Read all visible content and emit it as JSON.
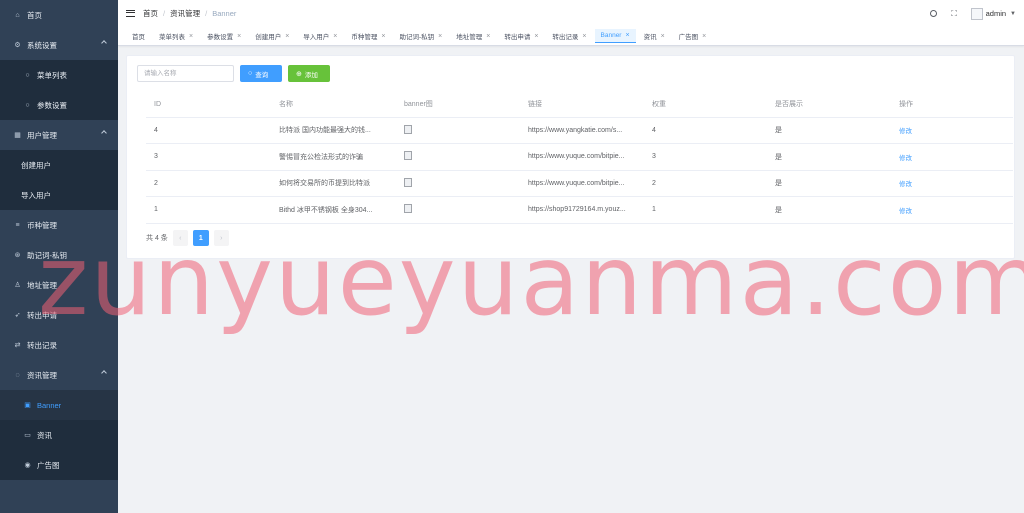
{
  "sidebar": {
    "items": [
      {
        "label": "首页",
        "icon": "home-icon",
        "type": "top"
      },
      {
        "label": "系统设置",
        "icon": "gear-icon",
        "type": "group"
      },
      {
        "label": "菜单列表",
        "icon": "circle-icon",
        "type": "sub"
      },
      {
        "label": "参数设置",
        "icon": "circle-icon",
        "type": "sub"
      },
      {
        "label": "用户管理",
        "icon": "users-icon",
        "type": "group"
      },
      {
        "label": "创建用户",
        "icon": "",
        "type": "subplain"
      },
      {
        "label": "导入用户",
        "icon": "",
        "type": "subplain"
      },
      {
        "label": "币种管理",
        "icon": "sliders-icon",
        "type": "top"
      },
      {
        "label": "助记词-私钥",
        "icon": "key-icon",
        "type": "top"
      },
      {
        "label": "地址管理",
        "icon": "user-icon",
        "type": "top"
      },
      {
        "label": "转出申请",
        "icon": "rocket-icon",
        "type": "top"
      },
      {
        "label": "转出记录",
        "icon": "transfer-icon",
        "type": "top"
      },
      {
        "label": "资讯管理",
        "icon": "chat-icon",
        "type": "group"
      },
      {
        "label": "Banner",
        "icon": "image-icon",
        "type": "sub",
        "active": true
      },
      {
        "label": "资讯",
        "icon": "message-icon",
        "type": "sub"
      },
      {
        "label": "广告图",
        "icon": "eye-icon",
        "type": "sub"
      }
    ]
  },
  "navbar": {
    "breadcrumb": [
      "首页",
      "资讯管理",
      "Banner"
    ],
    "user": "admin"
  },
  "tags": [
    {
      "label": "首页",
      "closable": false
    },
    {
      "label": "菜单列表",
      "closable": true
    },
    {
      "label": "参数设置",
      "closable": true
    },
    {
      "label": "创建用户",
      "closable": true
    },
    {
      "label": "导入用户",
      "closable": true
    },
    {
      "label": "币种管理",
      "closable": true
    },
    {
      "label": "助记词-私钥",
      "closable": true
    },
    {
      "label": "地址管理",
      "closable": true
    },
    {
      "label": "转出申请",
      "closable": true
    },
    {
      "label": "转出记录",
      "closable": true
    },
    {
      "label": "Banner",
      "closable": true,
      "active": true
    },
    {
      "label": "资讯",
      "closable": true
    },
    {
      "label": "广告图",
      "closable": true
    }
  ],
  "toolbar": {
    "search_placeholder": "请输入名称",
    "search_value": "",
    "query_label": "查询",
    "add_label": "添加"
  },
  "table": {
    "headers": [
      "ID",
      "名称",
      "banner图",
      "链接",
      "权重",
      "是否展示",
      "操作"
    ],
    "rows": [
      {
        "id": "4",
        "name": "比特派 国内功能最强大的钱...",
        "link": "https://www.yangkatie.com/s...",
        "weight": "4",
        "show": "是",
        "action": "修改"
      },
      {
        "id": "3",
        "name": "警惕冒充公检法形式的诈骗",
        "link": "https://www.yuque.com/bitpie...",
        "weight": "3",
        "show": "是",
        "action": "修改"
      },
      {
        "id": "2",
        "name": "如何将交易所的币提到比特派",
        "link": "https://www.yuque.com/bitpie...",
        "weight": "2",
        "show": "是",
        "action": "修改"
      },
      {
        "id": "1",
        "name": "Bithd 冰甲不锈钢板 全身304...",
        "link": "https://shop91729164.m.youz...",
        "weight": "1",
        "show": "是",
        "action": "修改"
      }
    ]
  },
  "pagination": {
    "total_label": "共 4 条",
    "current": "1"
  },
  "watermark": "zunyueyuanma.com",
  "colors": {
    "sidebar_bg": "#304156",
    "primary": "#409eff",
    "success": "#67c23a",
    "watermark": "#f06074"
  }
}
